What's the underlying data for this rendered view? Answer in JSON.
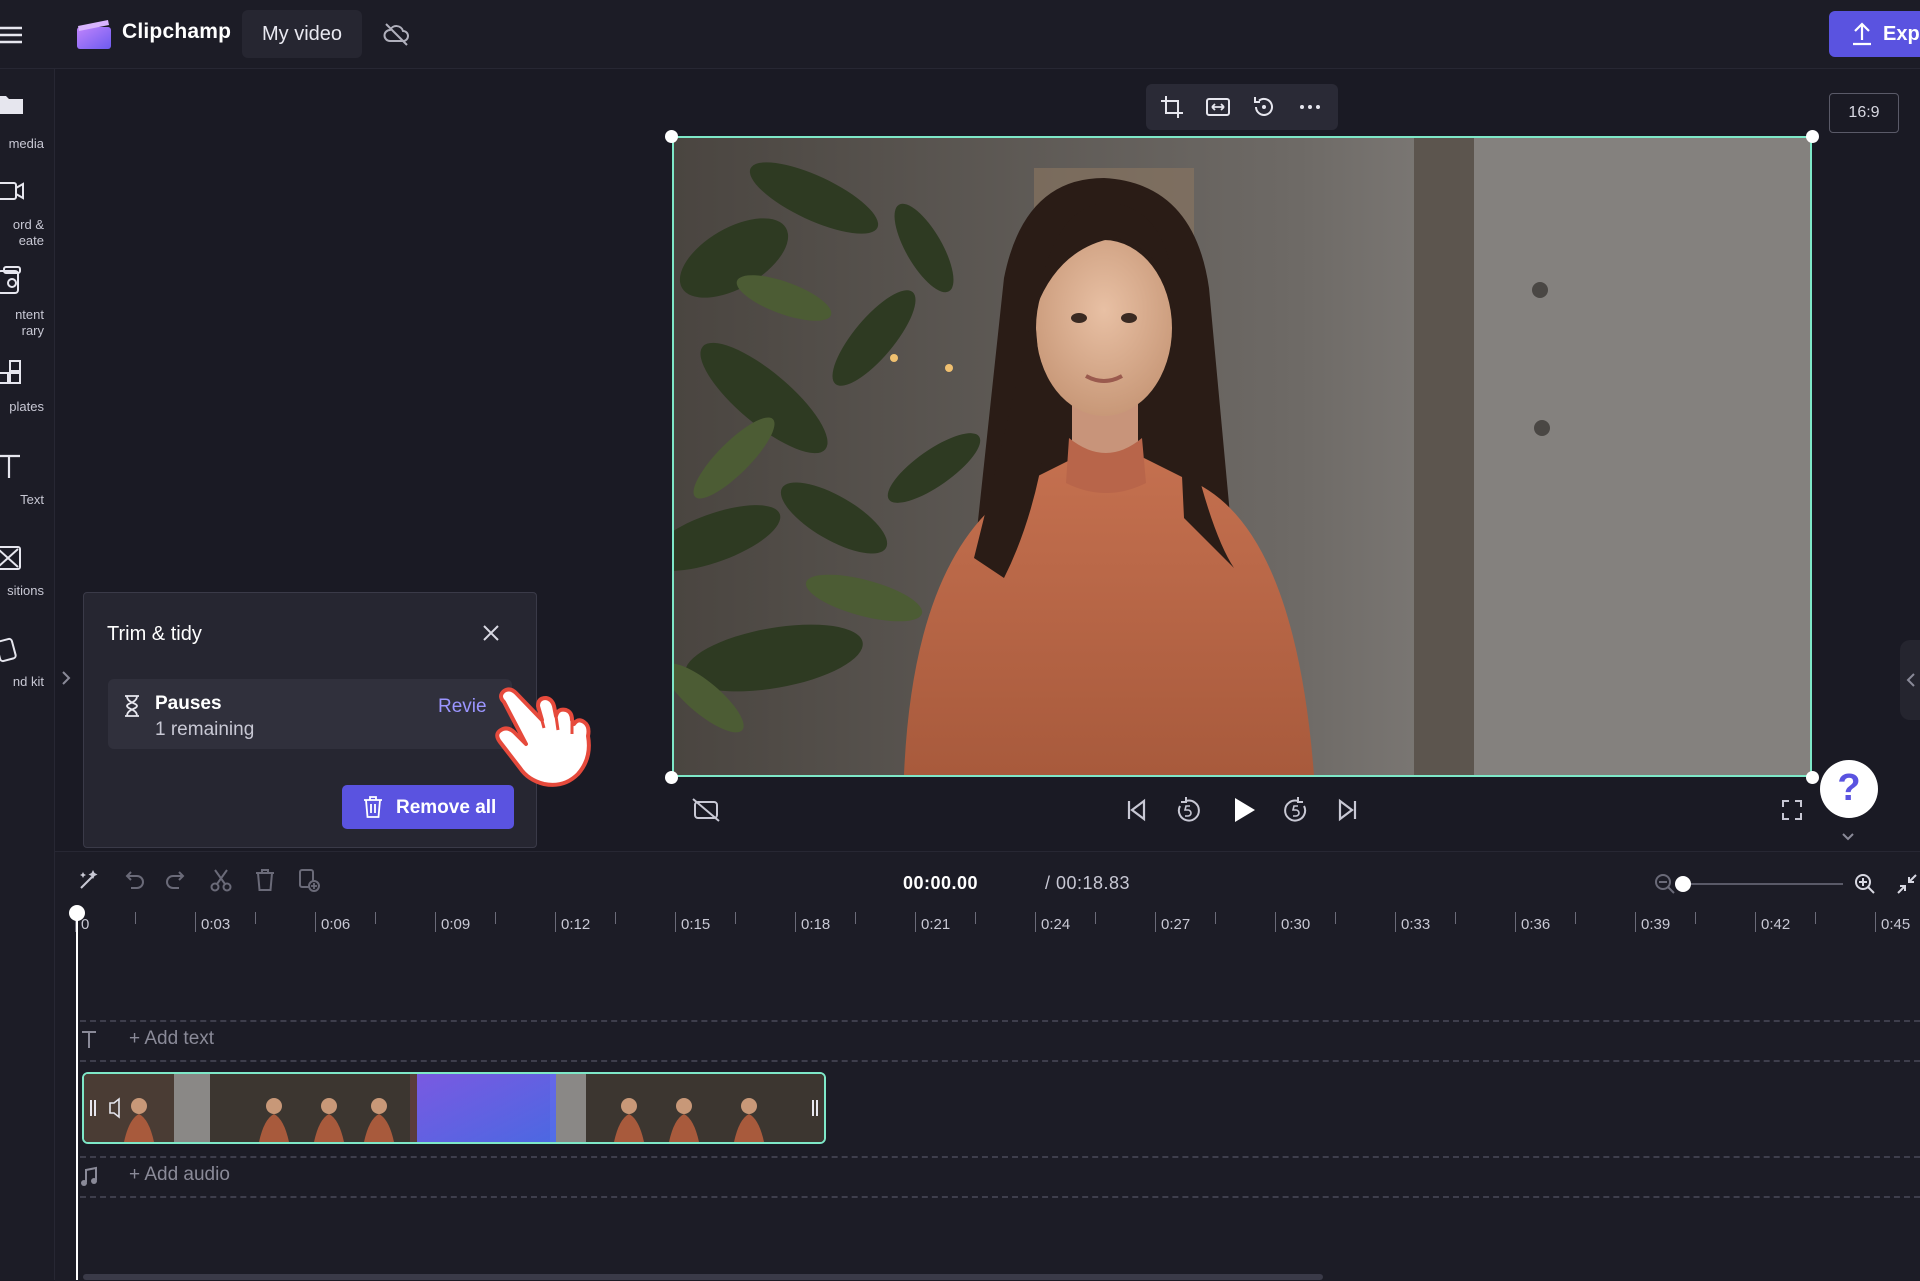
{
  "app": {
    "name": "Clipchamp",
    "project_name": "My video",
    "export_label": "Export",
    "accent": "#5a53e0",
    "selection_color": "#7ee8c8"
  },
  "sidebar": {
    "items": [
      {
        "label": "media",
        "icon": "folder-icon"
      },
      {
        "label": "ord &\neate",
        "icon": "video-camera-icon"
      },
      {
        "label": "ntent\nrary",
        "icon": "content-library-icon"
      },
      {
        "label": "plates",
        "icon": "templates-icon"
      },
      {
        "label": "Text",
        "icon": "text-icon"
      },
      {
        "label": "sitions",
        "icon": "transitions-icon"
      },
      {
        "label": "nd kit",
        "icon": "brand-kit-icon"
      }
    ]
  },
  "preview": {
    "aspect_ratio": "16:9",
    "toolbar": [
      "crop-icon",
      "fit-icon",
      "rotate-icon",
      "more-icon"
    ]
  },
  "trim_panel": {
    "title": "Trim & tidy",
    "item_title": "Pauses",
    "item_subtitle": "1 remaining",
    "review_label": "Revie",
    "remove_all_label": "Remove all"
  },
  "timeline": {
    "current_time": "00:00.00",
    "total_time": "/ 00:18.83",
    "ruler_labels": [
      "0",
      "0:03",
      "0:06",
      "0:09",
      "0:12",
      "0:15",
      "0:18",
      "0:21",
      "0:24",
      "0:27",
      "0:30",
      "0:33",
      "0:36",
      "0:39",
      "0:42",
      "0:45"
    ],
    "add_text_label": "+ Add text",
    "add_audio_label": "+ Add audio"
  }
}
